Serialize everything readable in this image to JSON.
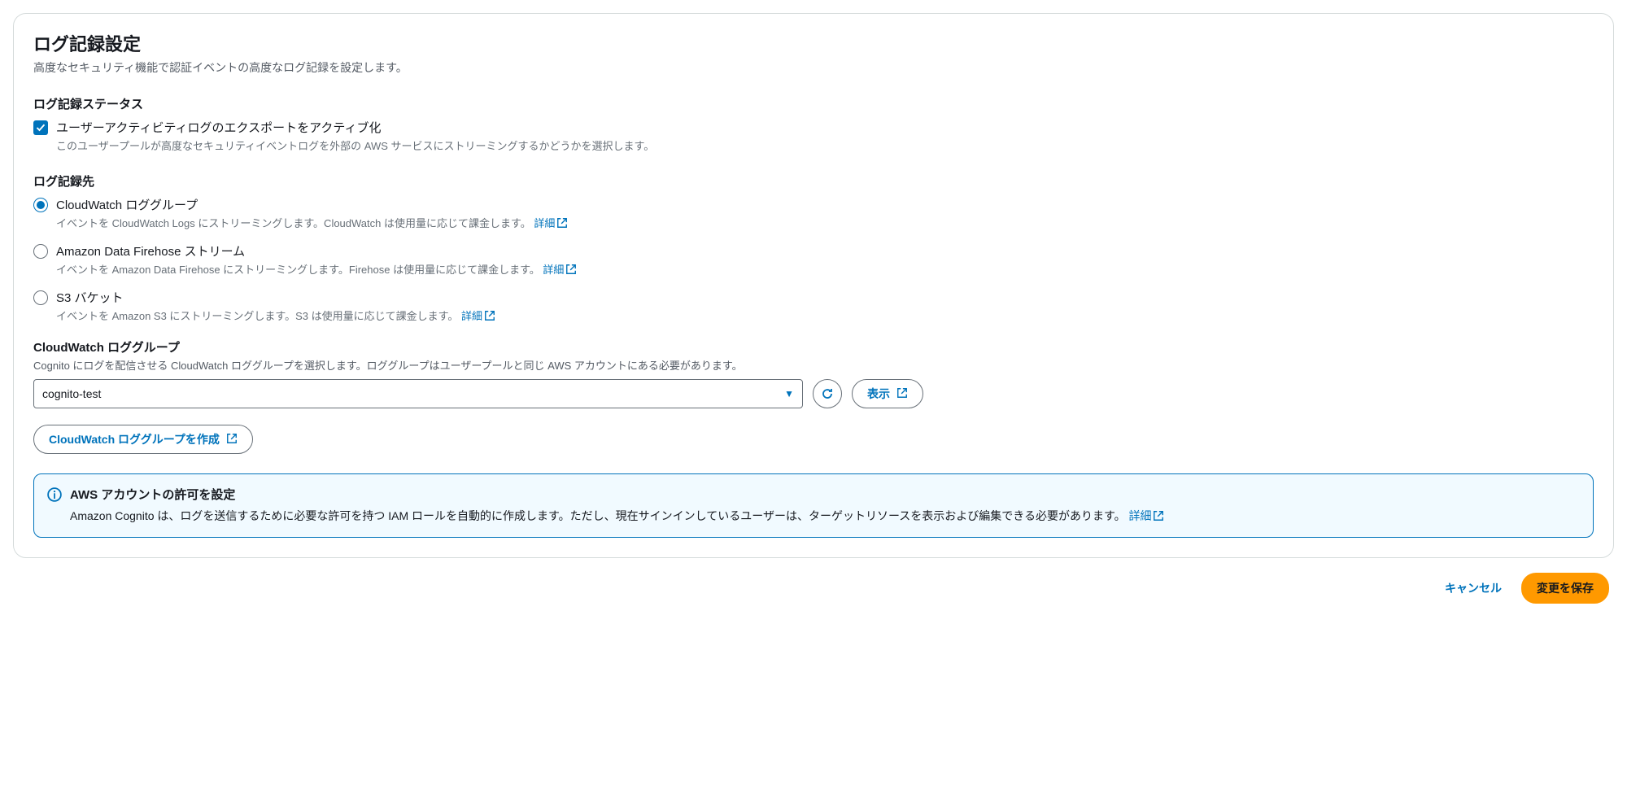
{
  "panel": {
    "title": "ログ記録設定",
    "description": "高度なセキュリティ機能で認証イベントの高度なログ記録を設定します。"
  },
  "status": {
    "heading": "ログ記録ステータス",
    "checkbox_label": "ユーザーアクティビティログのエクスポートをアクティブ化",
    "checkbox_desc": "このユーザープールが高度なセキュリティイベントログを外部の AWS サービスにストリーミングするかどうかを選択します。"
  },
  "destination": {
    "heading": "ログ記録先",
    "options": [
      {
        "label": "CloudWatch ロググループ",
        "desc": "イベントを CloudWatch Logs にストリーミングします。CloudWatch は使用量に応じて課金します。",
        "link": "詳細",
        "selected": true
      },
      {
        "label": "Amazon Data Firehose ストリーム",
        "desc": "イベントを Amazon Data Firehose にストリーミングします。Firehose は使用量に応じて課金します。",
        "link": "詳細",
        "selected": false
      },
      {
        "label": "S3 バケット",
        "desc": "イベントを Amazon S3 にストリーミングします。S3 は使用量に応じて課金します。",
        "link": "詳細",
        "selected": false
      }
    ]
  },
  "loggroup": {
    "label": "CloudWatch ロググループ",
    "desc": "Cognito にログを配信させる CloudWatch ロググループを選択します。ロググループはユーザープールと同じ AWS アカウントにある必要があります。",
    "selected_value": "cognito-test",
    "view_button": "表示",
    "create_button": "CloudWatch ロググループを作成"
  },
  "info": {
    "title": "AWS アカウントの許可を設定",
    "text": "Amazon Cognito は、ログを送信するために必要な許可を持つ IAM ロールを自動的に作成します。ただし、現在サインインしているユーザーは、ターゲットリソースを表示および編集できる必要があります。",
    "link": "詳細"
  },
  "footer": {
    "cancel": "キャンセル",
    "save": "変更を保存"
  }
}
